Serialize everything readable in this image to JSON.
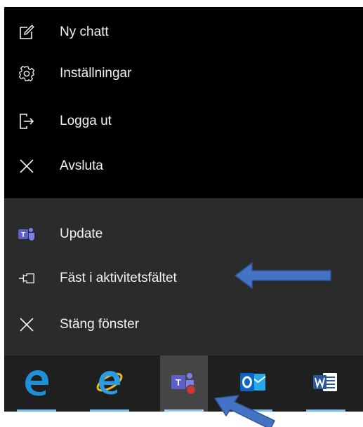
{
  "app_menu": {
    "items": [
      {
        "label": "Ny chatt",
        "icon": "new-chat-icon"
      },
      {
        "label": "Inställningar",
        "icon": "gear-icon"
      },
      {
        "label": "Logga ut",
        "icon": "sign-out-icon"
      },
      {
        "label": "Avsluta",
        "icon": "close-icon"
      }
    ]
  },
  "jump_list": {
    "items": [
      {
        "label": "Update",
        "icon": "teams-icon"
      },
      {
        "label": "Fäst i aktivitetsfältet",
        "icon": "pin-icon"
      },
      {
        "label": "Stäng fönster",
        "icon": "close-icon"
      }
    ]
  },
  "taskbar": {
    "apps": [
      "edge-icon",
      "internet-explorer-icon",
      "teams-icon",
      "outlook-icon",
      "word-icon"
    ],
    "active": "teams"
  },
  "colors": {
    "menu_top_bg": "#000000",
    "menu_bottom_bg": "#2b2b2b",
    "taskbar_bg": "#1f1f1f",
    "annotation_arrow": "#4472c4",
    "teams_purple": "#5b5fc7",
    "notification_dot": "#d13438"
  }
}
